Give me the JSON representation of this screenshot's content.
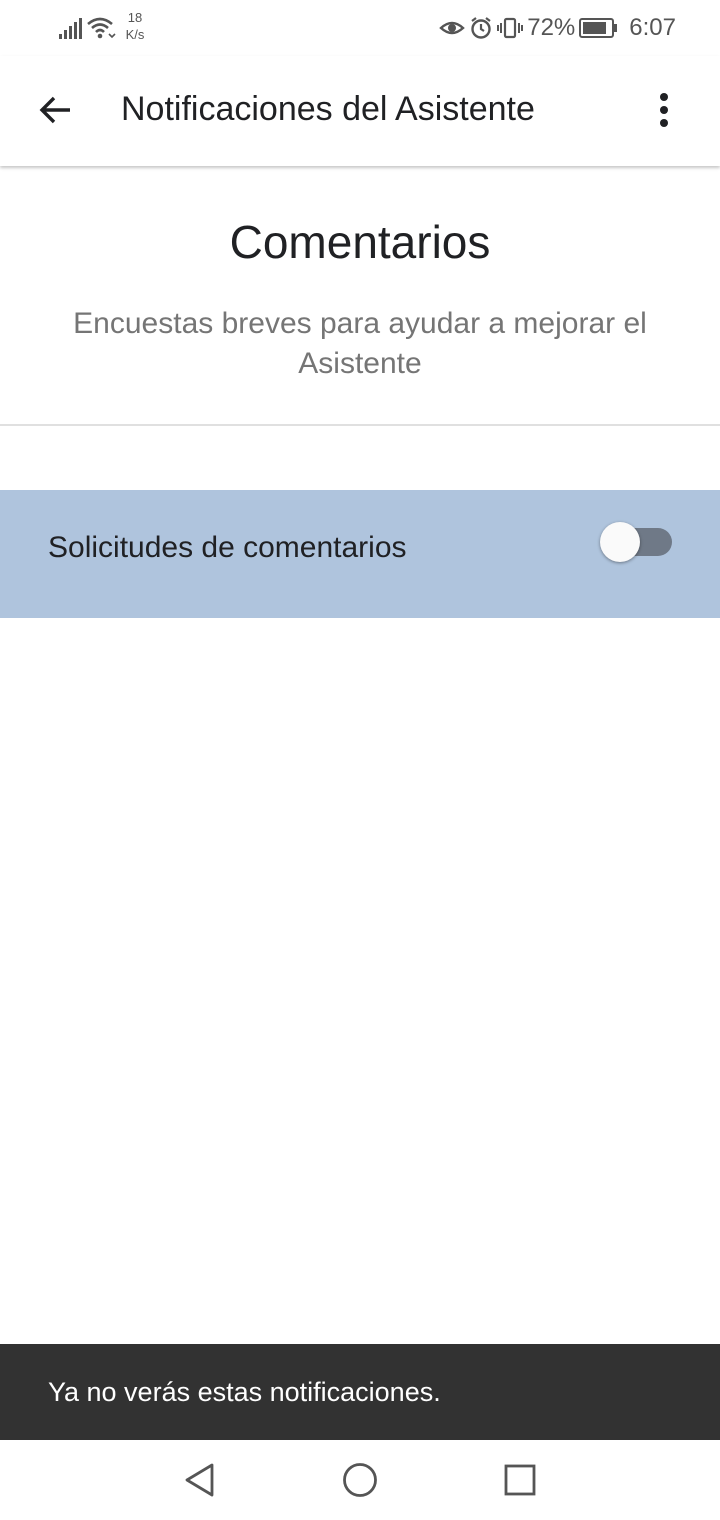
{
  "status_bar": {
    "net_speed_value": "18",
    "net_speed_unit": "K/s",
    "battery_percent": "72%",
    "time": "6:07",
    "icons": [
      "signal-icon",
      "wifi-icon",
      "eye-icon",
      "alarm-icon",
      "vibrate-icon",
      "battery-icon"
    ]
  },
  "app_bar": {
    "title": "Notificaciones del Asistente",
    "back_icon": "arrow-left-icon",
    "menu_icon": "more-vert-icon"
  },
  "section": {
    "title": "Comentarios",
    "subtitle": "Encuestas breves para ayudar a mejorar el Asistente"
  },
  "setting": {
    "label": "Solicitudes de comentarios",
    "enabled": false
  },
  "snackbar": {
    "message": "Ya no verás estas notificaciones."
  },
  "nav_bar": {
    "icons": [
      "nav-back-icon",
      "nav-home-icon",
      "nav-recents-icon"
    ]
  },
  "colors": {
    "highlight_row": "#afc4dd",
    "snackbar_bg": "#323232",
    "toggle_track_off": "#6f7987"
  }
}
